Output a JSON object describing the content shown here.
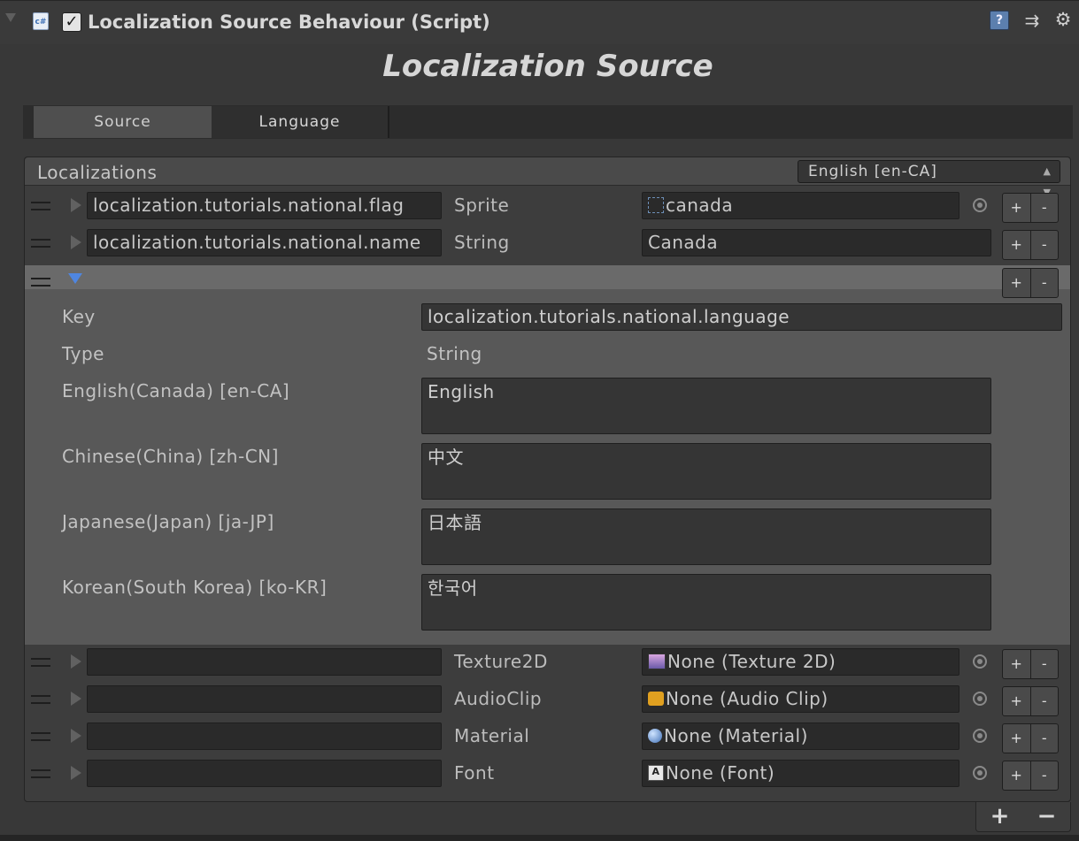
{
  "component": {
    "title": "Localization Source Behaviour (Script)",
    "script_icon_label": "c#",
    "enabled": true,
    "icons": [
      "help-icon",
      "preset-icon",
      "gear-icon"
    ]
  },
  "inspector_title": "Localization Source",
  "tabs": [
    {
      "label": "Source",
      "selected": true
    },
    {
      "label": "Language",
      "selected": false
    }
  ],
  "list": {
    "title": "Localizations",
    "language_selected": "English [en-CA]",
    "footer_add": "+",
    "footer_remove": "−"
  },
  "rows": [
    {
      "key": "localization.tutorials.national.flag",
      "type": "Sprite",
      "value": "canada",
      "value_icon": "sprite-icon",
      "has_picker": true,
      "add": "+",
      "remove": "-"
    },
    {
      "key": "localization.tutorials.national.name",
      "type": "String",
      "value": "Canada",
      "has_picker": false,
      "add": "+",
      "remove": "-"
    },
    {
      "key": "",
      "type": "Texture2D",
      "value": "None (Texture 2D)",
      "value_icon": "texture-icon",
      "has_picker": true,
      "add": "+",
      "remove": "-"
    },
    {
      "key": "",
      "type": "AudioClip",
      "value": "None (Audio Clip)",
      "value_icon": "audio-clip-icon",
      "has_picker": true,
      "add": "+",
      "remove": "-"
    },
    {
      "key": "",
      "type": "Material",
      "value": "None (Material)",
      "value_icon": "material-icon",
      "has_picker": true,
      "add": "+",
      "remove": "-"
    },
    {
      "key": "",
      "type": "Font",
      "value": "None (Font)",
      "value_icon": "font-icon",
      "has_picker": true,
      "add": "+",
      "remove": "-"
    }
  ],
  "expanded": {
    "add": "+",
    "remove": "-",
    "key_label": "Key",
    "key_value": "localization.tutorials.national.language",
    "type_label": "Type",
    "type_value": "String",
    "languages": [
      {
        "label": "English(Canada) [en-CA]",
        "value": "English"
      },
      {
        "label": "Chinese(China) [zh-CN]",
        "value": "中文"
      },
      {
        "label": "Japanese(Japan) [ja-JP]",
        "value": "日本語"
      },
      {
        "label": "Korean(South Korea) [ko-KR]",
        "value": "한국어"
      }
    ]
  }
}
